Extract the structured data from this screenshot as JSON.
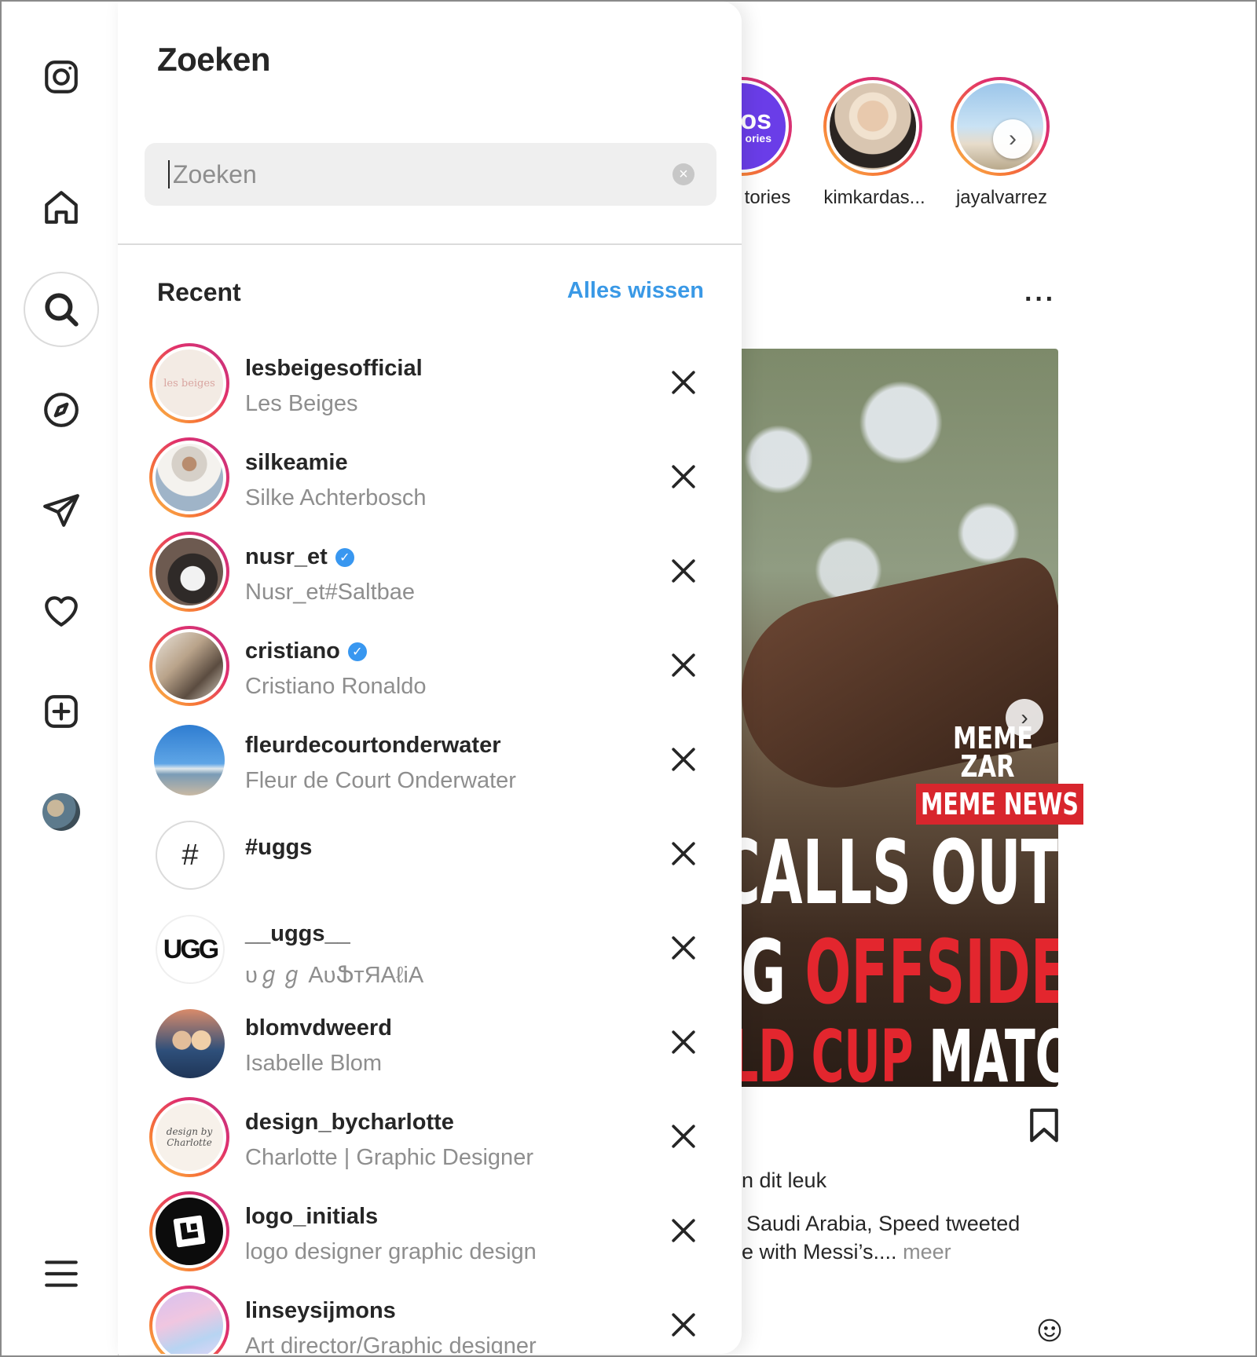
{
  "panel": {
    "title": "Zoeken",
    "search_placeholder": "Zoeken",
    "recent_label": "Recent",
    "clear_all": "Alles wissen"
  },
  "recent": [
    {
      "username": "lesbeigesofficial",
      "fullname": "Les Beiges",
      "verified": false,
      "avatar_text": "les beiges"
    },
    {
      "username": "silkeamie",
      "fullname": "Silke Achterbosch",
      "verified": false
    },
    {
      "username": "nusr_et",
      "fullname": "Nusr_et#Saltbae",
      "verified": true
    },
    {
      "username": "cristiano",
      "fullname": "Cristiano Ronaldo",
      "verified": true
    },
    {
      "username": "fleurdecourtonderwater",
      "fullname": "Fleur de Court Onderwater",
      "verified": false
    },
    {
      "username": "#uggs",
      "fullname": "",
      "verified": false,
      "avatar_text": "#"
    },
    {
      "username": "__uggs__",
      "fullname": "υℊℊ ΑυՖтЯΑℓiΑ",
      "verified": false,
      "avatar_text": "UGG"
    },
    {
      "username": "blomvdweerd",
      "fullname": "Isabelle Blom",
      "verified": false
    },
    {
      "username": "design_bycharlotte",
      "fullname": "Charlotte | Graphic Designer",
      "verified": false,
      "avatar_text": "design by Charlotte"
    },
    {
      "username": "logo_initials",
      "fullname": "logo designer graphic design",
      "verified": false
    },
    {
      "username": "linseysijmons",
      "fullname": "Art director/Graphic designer",
      "verified": false
    }
  ],
  "stories": [
    {
      "label": "tories",
      "badge": "os",
      "badge_sub": "ories"
    },
    {
      "label": "kimkardas..."
    },
    {
      "label": "jayalvarrez"
    }
  ],
  "post": {
    "overlay_logo": "MEME ZAR",
    "overlay_tag": "MEME NEWS",
    "headline_1": "CALLS OUT",
    "headline_2_white": "NG ",
    "headline_2_red": "OFFSIDE",
    "headline_3_red": "RLD CUP ",
    "headline_3_white": "MATCH",
    "likes_text": "n dit leuk",
    "caption_line1": "Saudi Arabia, Speed tweeted",
    "caption_line2": "e with Messi’s....",
    "more": "meer"
  },
  "colors": {
    "accent_link": "#3a99e6",
    "verified": "#3897f0",
    "meme_red": "#e3262e"
  },
  "icons": {
    "rail": [
      "instagram-logo-icon",
      "home-icon",
      "search-icon",
      "explore-icon",
      "messages-icon",
      "notifications-heart-icon",
      "create-icon",
      "profile-avatar",
      "menu-icon"
    ]
  }
}
